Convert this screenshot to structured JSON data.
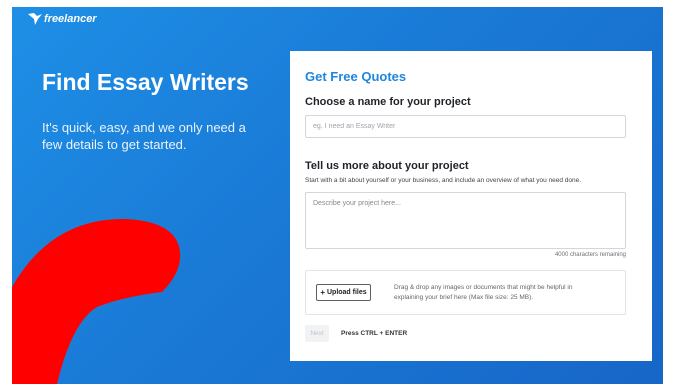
{
  "brand": {
    "logo_text": "freelancer"
  },
  "hero": {
    "title": "Find Essay Writers",
    "subtitle": "It's quick, easy, and we only need a few details to get started."
  },
  "form": {
    "heading": "Get Free Quotes",
    "name_label": "Choose a name for your project",
    "name_placeholder": "eg. I need an Essay Writer",
    "about_label": "Tell us more about your project",
    "about_helper": "Start with a bit about yourself or your business, and include an overview of what you need done.",
    "description_placeholder": "Describe your project here...",
    "char_counter": "4000 characters remaining",
    "upload_button": "Upload files",
    "upload_hint": "Drag & drop any images or documents that might be helpful in explaining your brief here (Max file size: 25 MB).",
    "next_button": "Next",
    "shortcut_hint": "Press CTRL + ENTER"
  },
  "colors": {
    "background_blue": "#1a7ad6",
    "accent_blue": "#1f86e0",
    "swoosh_red": "#ff0000"
  },
  "icons": [
    "freelancer-bird-icon",
    "plus-icon",
    "resize-handle-icon"
  ]
}
